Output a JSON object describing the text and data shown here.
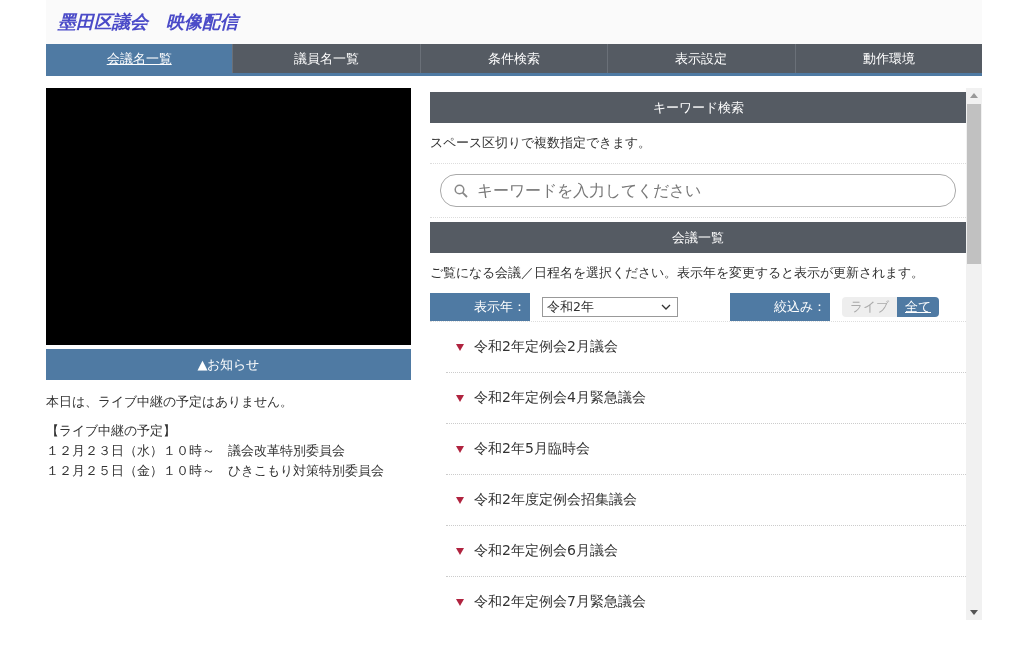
{
  "header": {
    "title": "墨田区議会　映像配信"
  },
  "tabs": [
    {
      "label": "会議名一覧",
      "selected": true
    },
    {
      "label": "議員名一覧",
      "selected": false
    },
    {
      "label": "条件検索",
      "selected": false
    },
    {
      "label": "表示設定",
      "selected": false
    },
    {
      "label": "動作環境",
      "selected": false
    }
  ],
  "notice": {
    "title": "▲お知らせ",
    "message": "本日は、ライブ中継の予定はありません。",
    "schedule_heading": "【ライブ中継の予定】",
    "schedule": [
      "１２月２３日（水）１０時～　議会改革特別委員会",
      "１２月２５日（金）１０時～　ひきこもり対策特別委員会"
    ]
  },
  "keyword_search": {
    "title": "キーワード検索",
    "hint": "スペース区切りで複数指定できます。",
    "placeholder": "キーワードを入力してください"
  },
  "meetings": {
    "title": "会議一覧",
    "hint": "ご覧になる会議／日程名を選択ください。表示年を変更すると表示が更新されます。",
    "year_label": "表示年：",
    "year_value": "令和2年",
    "filter_label": "絞込み：",
    "filters": [
      {
        "label": "ライブ",
        "selected": false
      },
      {
        "label": "全て",
        "selected": true
      }
    ],
    "items": [
      "令和2年定例会2月議会",
      "令和2年定例会4月緊急議会",
      "令和2年5月臨時会",
      "令和2年度定例会招集議会",
      "令和2年定例会6月議会",
      "令和2年定例会7月緊急議会"
    ]
  }
}
